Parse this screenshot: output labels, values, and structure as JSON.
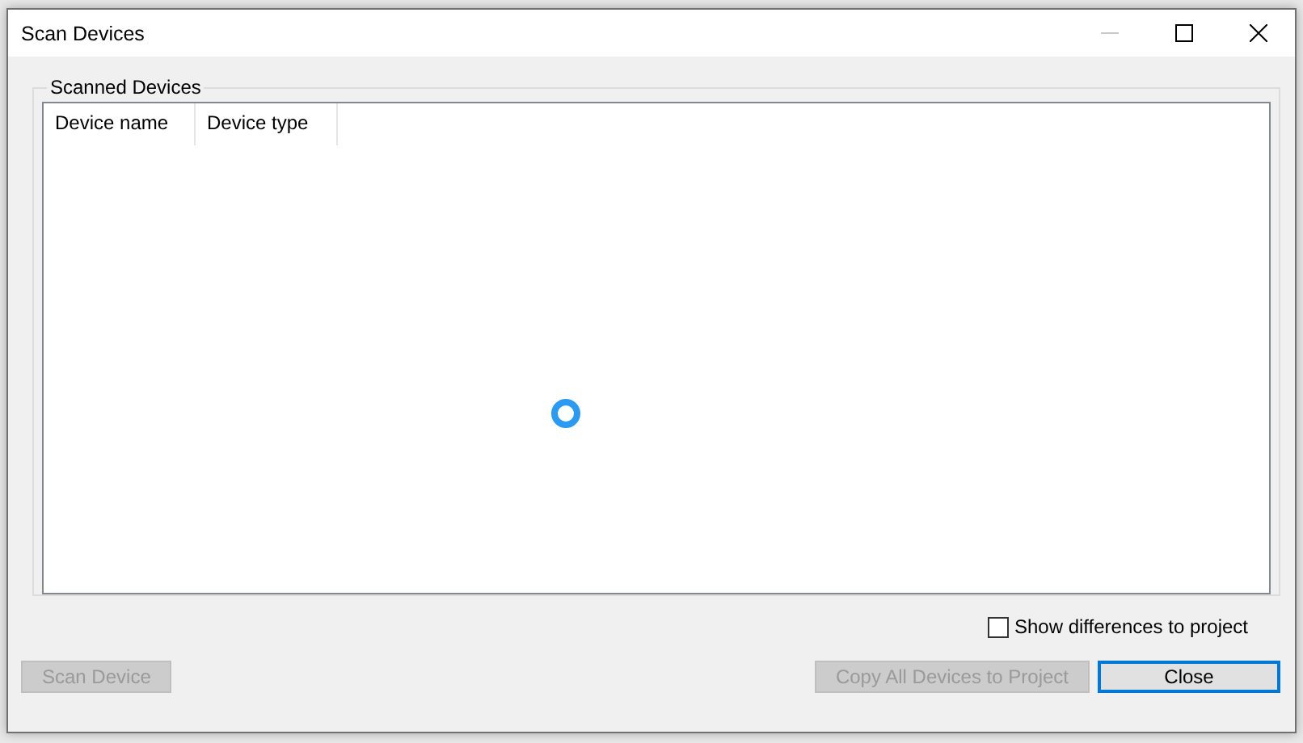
{
  "window": {
    "title": "Scan Devices",
    "minimize_disabled": true
  },
  "group": {
    "title": "Scanned Devices",
    "columns": [
      "Device name",
      "Device type"
    ],
    "loading": true
  },
  "show_differences": {
    "label": "Show differences to project",
    "checked": false
  },
  "buttons": [
    {
      "label": "Scan Device",
      "disabled": true,
      "focused": false
    },
    {
      "label": "Copy All Devices to Project",
      "disabled": true,
      "focused": false
    },
    {
      "label": "Close",
      "disabled": false,
      "focused": true
    }
  ]
}
